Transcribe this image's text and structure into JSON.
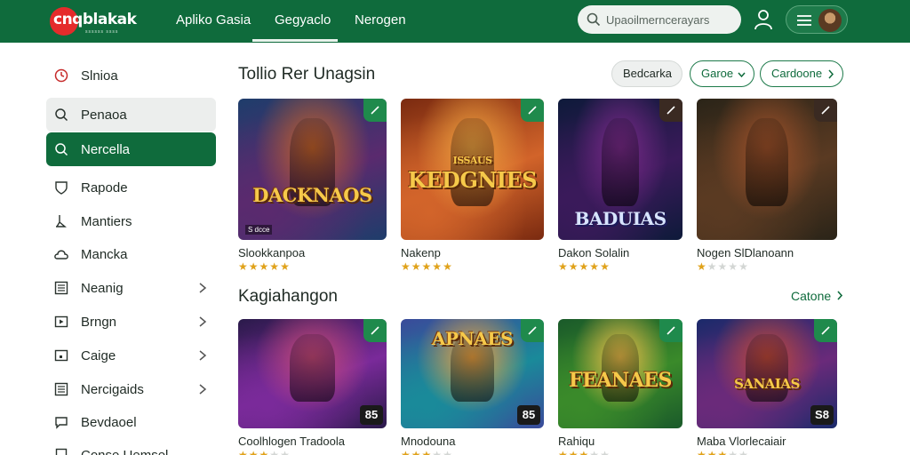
{
  "header": {
    "logo_text": "cnqblakak",
    "logo_sub": "ssssss ssss",
    "nav": [
      {
        "label": "Apliko Gasia"
      },
      {
        "label": "Gegyaclo"
      },
      {
        "label": "Nerogen"
      }
    ],
    "search": {
      "placeholder": "Upaoilmerncerayars"
    },
    "icons": {
      "search": "search-icon",
      "user": "user-icon",
      "menu": "menu-icon",
      "avatar": "avatar"
    }
  },
  "sidebar": {
    "items": [
      {
        "label": "Slnioa",
        "icon": "clock-icon"
      },
      {
        "label": "Penaoa",
        "icon": "search-icon"
      },
      {
        "label": "Nercella",
        "icon": "search-icon"
      },
      {
        "label": "Rapode",
        "icon": "shield-icon"
      },
      {
        "label": "Mantiers",
        "icon": "pin-icon"
      },
      {
        "label": "Mancka",
        "icon": "cloud-icon"
      },
      {
        "label": "Neanig",
        "icon": "grid-icon"
      },
      {
        "label": "Brngn",
        "icon": "play-icon"
      },
      {
        "label": "Caige",
        "icon": "box-icon"
      },
      {
        "label": "Nercigaids",
        "icon": "grid-icon"
      },
      {
        "label": "Bevdaoel",
        "icon": "chat-icon"
      },
      {
        "label": "Conse Uemsel",
        "icon": "doc-icon"
      }
    ]
  },
  "main": {
    "section1": {
      "title": "Tollio Rer Unagsin",
      "buttons": [
        "Bedcarka",
        "Garoe",
        "Cardoone"
      ]
    },
    "row1": [
      {
        "name": "Slookkanpoa",
        "art_title": "DACKNAOS",
        "tag": "S dcce",
        "rating": 5,
        "colors": [
          "#1e3d6b",
          "#5a2a6e",
          "#c4622a"
        ]
      },
      {
        "name": "Nakenp",
        "art_title": "KEDGNIES",
        "art_sub": "ISSAUS",
        "rating": 5,
        "colors": [
          "#7a2a10",
          "#d2642a",
          "#f0a340"
        ]
      },
      {
        "name": "Dakon Solalin",
        "art_title": "BADUIAS",
        "rating": 5,
        "colors": [
          "#0e1a3a",
          "#3a1a5a",
          "#7a2a8a"
        ]
      },
      {
        "name": "Nogen SlDlanoann",
        "art_title": "",
        "rating": 1,
        "colors": [
          "#2a2418",
          "#5a3a22",
          "#a0522a"
        ]
      }
    ],
    "section2": {
      "title": "Kagiahangon",
      "see_all": "Catone"
    },
    "row2": [
      {
        "name": "Coolhlogen Tradoola",
        "art_title": "",
        "corner": "85",
        "rating": 3,
        "colors": [
          "#2a1a4a",
          "#7a2a9a",
          "#c94a7a"
        ]
      },
      {
        "name": "Mnodouna",
        "art_title": "APNAES",
        "corner": "85",
        "rating": 3,
        "colors": [
          "#3a4a9a",
          "#1a8a9a",
          "#f0a340"
        ]
      },
      {
        "name": "Rahiqu",
        "art_title": "FEANAES",
        "rating": 3,
        "colors": [
          "#1a5a2a",
          "#3a8a2a",
          "#f0c04a"
        ]
      },
      {
        "name": "Maba Vlorlecaiair",
        "art_title": "SANAIAS",
        "corner": "S8",
        "rating": 3,
        "colors": [
          "#1a2a6a",
          "#6a2a7a",
          "#c44a3a"
        ]
      }
    ]
  },
  "colors": {
    "primary": "#0f6b3c",
    "accent_star": "#e0a21a",
    "logo_red": "#e52b2b"
  }
}
